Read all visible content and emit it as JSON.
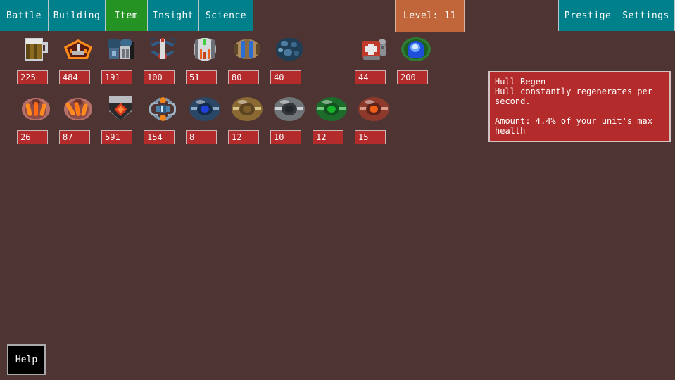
{
  "navbar": {
    "left_tabs": [
      {
        "label": "Battle",
        "active": false
      },
      {
        "label": "Building",
        "active": false
      },
      {
        "label": "Item",
        "active": true
      },
      {
        "label": "Insight",
        "active": false
      },
      {
        "label": "Science",
        "active": false
      }
    ],
    "right_tabs": [
      {
        "label": "Prestige",
        "active": false
      },
      {
        "label": "Settings",
        "active": false
      }
    ],
    "level_badge": "Level: 11",
    "colors": {
      "tab": "#00808a",
      "tab_active": "#249324",
      "level_badge": "#c1663a",
      "background": "#4e3433"
    }
  },
  "items": {
    "row1": [
      {
        "icon": "beer-mug-icon",
        "count": "225"
      },
      {
        "icon": "crown-hex-icon",
        "count": "484"
      },
      {
        "icon": "engine-block-icon",
        "count": "191"
      },
      {
        "icon": "drone-wings-icon",
        "count": "100"
      },
      {
        "icon": "reactor-pod-icon",
        "count": "51"
      },
      {
        "icon": "dual-rods-icon",
        "count": "80"
      },
      {
        "icon": "blue-rock-icon",
        "count": "40"
      },
      {
        "icon": "medkit-icon",
        "count": "44"
      },
      {
        "icon": "shield-orb-icon",
        "count": "200"
      }
    ],
    "row2": [
      {
        "icon": "orange-claw-icon",
        "count": "26"
      },
      {
        "icon": "orange-claw-alt-icon",
        "count": "87"
      },
      {
        "icon": "red-gem-plate-icon",
        "count": "591"
      },
      {
        "icon": "linker-node-icon",
        "count": "154"
      },
      {
        "icon": "blue-gem-icon",
        "count": "8"
      },
      {
        "icon": "gold-gem-icon",
        "count": "12"
      },
      {
        "icon": "silver-gem-icon",
        "count": "10"
      },
      {
        "icon": "green-gem-icon",
        "count": "12"
      },
      {
        "icon": "red-gem-icon",
        "count": "15"
      }
    ],
    "count_box_color": "#b32b2b"
  },
  "tooltip": {
    "title": "Hull Regen",
    "description": "Hull constantly regenerates per\nsecond.",
    "amount": "Amount: 4.4% of your unit's max\nhealth",
    "color": "#b32b2b"
  },
  "help": {
    "label": "Help"
  }
}
